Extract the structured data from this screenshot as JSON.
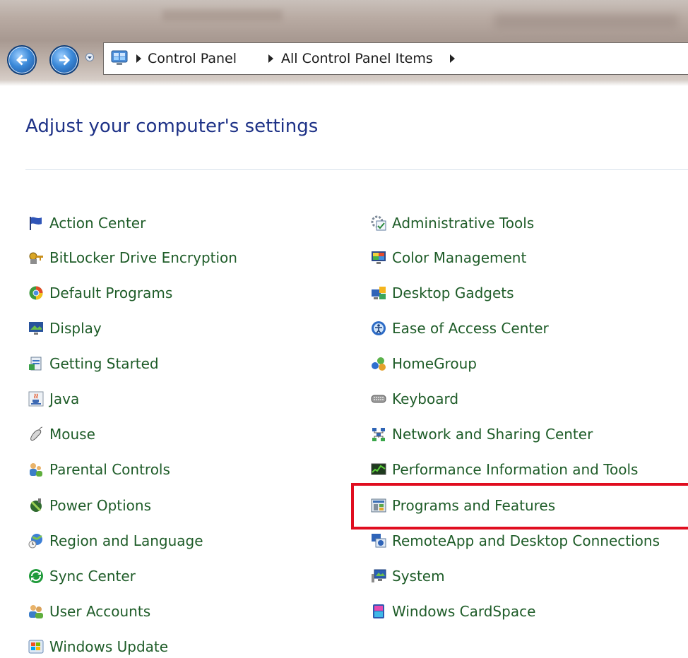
{
  "window": {
    "breadcrumb": [
      "Control Panel",
      "All Control Panel Items"
    ]
  },
  "page": {
    "heading": "Adjust your computer's settings"
  },
  "items_left": [
    {
      "label": "Action Center",
      "icon": "flag-icon"
    },
    {
      "label": "BitLocker Drive Encryption",
      "icon": "bitlocker-key-icon"
    },
    {
      "label": "Default Programs",
      "icon": "default-programs-icon"
    },
    {
      "label": "Display",
      "icon": "display-monitor-icon"
    },
    {
      "label": "Getting Started",
      "icon": "getting-started-icon"
    },
    {
      "label": "Java",
      "icon": "java-cup-icon"
    },
    {
      "label": "Mouse",
      "icon": "mouse-icon"
    },
    {
      "label": "Parental Controls",
      "icon": "parental-controls-icon"
    },
    {
      "label": "Power Options",
      "icon": "power-options-icon"
    },
    {
      "label": "Region and Language",
      "icon": "globe-clock-icon"
    },
    {
      "label": "Sync Center",
      "icon": "sync-icon"
    },
    {
      "label": "User Accounts",
      "icon": "users-icon"
    },
    {
      "label": "Windows Update",
      "icon": "windows-update-icon"
    }
  ],
  "items_right": [
    {
      "label": "Administrative Tools",
      "icon": "administrative-tools-icon"
    },
    {
      "label": "Color Management",
      "icon": "color-management-icon"
    },
    {
      "label": "Desktop Gadgets",
      "icon": "desktop-gadgets-icon"
    },
    {
      "label": "Ease of Access Center",
      "icon": "ease-of-access-icon"
    },
    {
      "label": "HomeGroup",
      "icon": "homegroup-icon"
    },
    {
      "label": "Keyboard",
      "icon": "keyboard-icon"
    },
    {
      "label": "Network and Sharing Center",
      "icon": "network-icon"
    },
    {
      "label": "Performance Information and Tools",
      "icon": "performance-icon"
    },
    {
      "label": "Programs and Features",
      "icon": "programs-features-icon",
      "highlighted": true
    },
    {
      "label": "RemoteApp and Desktop Connections",
      "icon": "remoteapp-icon"
    },
    {
      "label": "System",
      "icon": "system-icon"
    },
    {
      "label": "Windows CardSpace",
      "icon": "cardspace-icon"
    }
  ],
  "colors": {
    "link": "#1e5c28",
    "heading": "#1e3287",
    "highlight": "#e00d1f"
  }
}
